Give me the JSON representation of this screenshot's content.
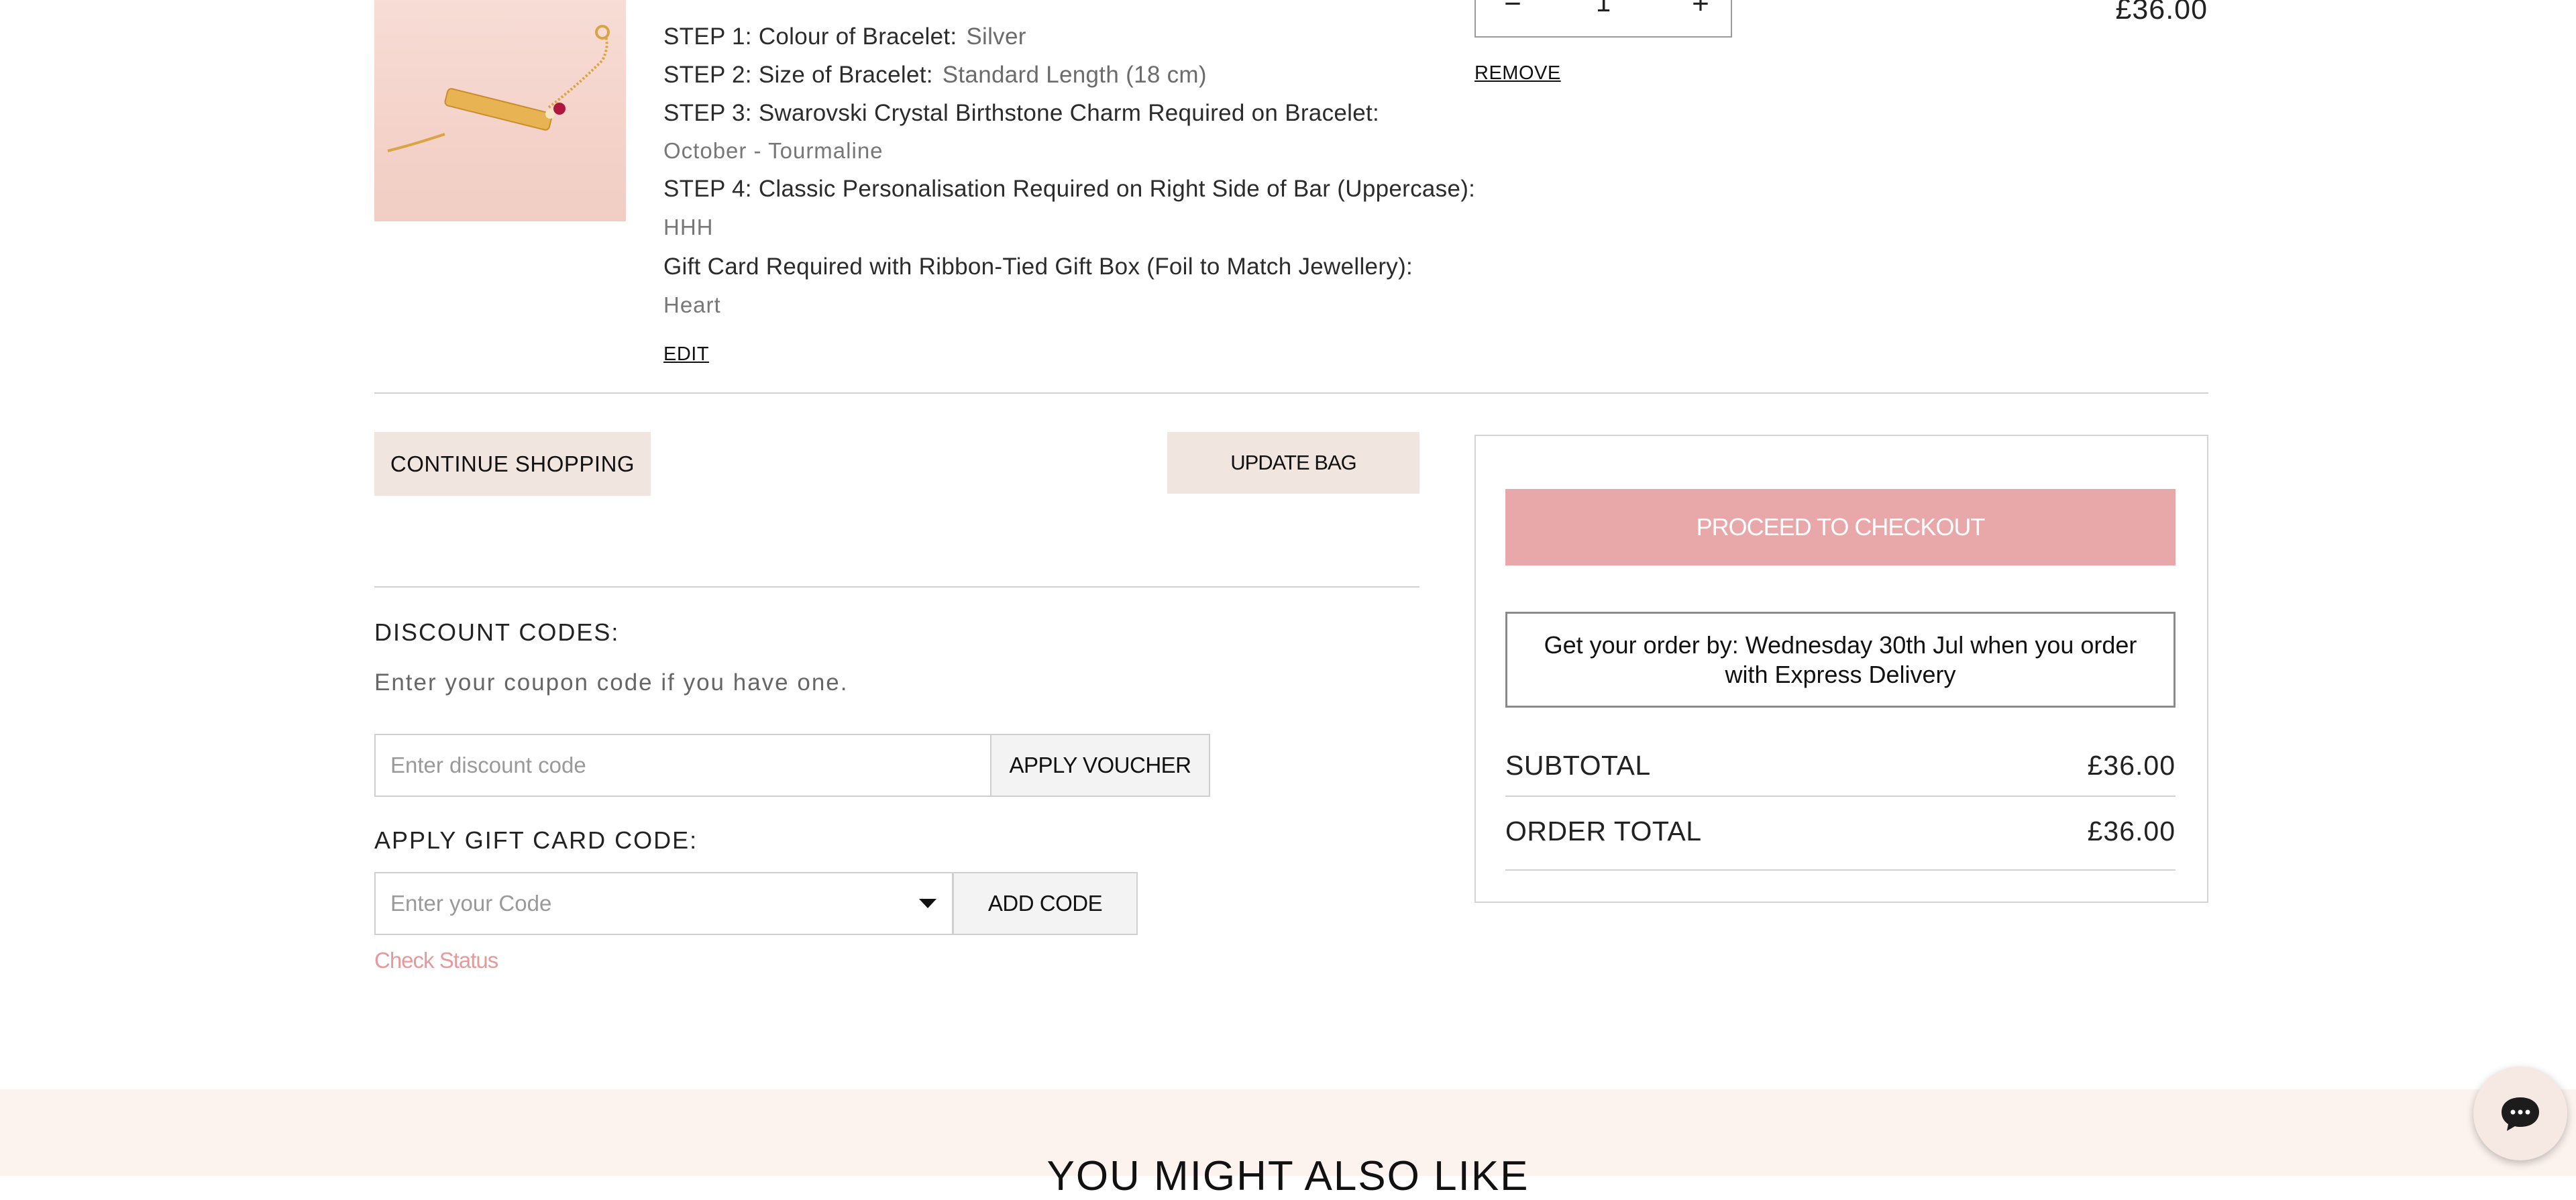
{
  "product": {
    "image_alt": "Gold bar bracelet",
    "options": [
      {
        "label": "STEP 1: Colour of Bracelet:",
        "value": "Silver"
      },
      {
        "label": "STEP 2: Size of Bracelet:",
        "value": "Standard Length (18 cm)"
      },
      {
        "label": "STEP 3: Swarovski Crystal Birthstone Charm Required on Bracelet:",
        "value": "October - Tourmaline"
      },
      {
        "label": "STEP 4: Classic Personalisation Required on Right Side of Bar (Uppercase):",
        "value": "HHH"
      },
      {
        "label": "Gift Card Required with Ribbon-Tied Gift Box (Foil to Match Jewellery):",
        "value": "Heart"
      }
    ],
    "edit_label": "EDIT",
    "remove_label": "REMOVE",
    "quantity": "1",
    "qty_minus": "−",
    "qty_plus": "+",
    "price": "£36.00"
  },
  "actions": {
    "continue_shopping": "CONTINUE SHOPPING",
    "update_bag": "UPDATE BAG"
  },
  "discount": {
    "title": "DISCOUNT CODES:",
    "helper": "Enter your coupon code if you have one.",
    "placeholder": "Enter discount code",
    "apply_label": "APPLY VOUCHER"
  },
  "gift_card": {
    "title": "APPLY GIFT CARD CODE:",
    "placeholder": "Enter your Code",
    "add_label": "ADD CODE",
    "check_status": "Check Status"
  },
  "summary": {
    "checkout_label": "PROCEED TO CHECKOUT",
    "delivery_msg": "Get your order by: Wednesday 30th Jul when you order with Express Delivery",
    "subtotal_label": "SUBTOTAL",
    "subtotal_value": "£36.00",
    "total_label": "ORDER TOTAL",
    "total_value": "£36.00"
  },
  "recommend": {
    "title": "YOU MIGHT ALSO LIKE"
  },
  "colors": {
    "accent_pink": "#e8a8aa",
    "beige": "#f1e5df",
    "link_pink": "#e49a9b"
  },
  "icons": [
    "chevron-down-icon",
    "chat-icon"
  ]
}
